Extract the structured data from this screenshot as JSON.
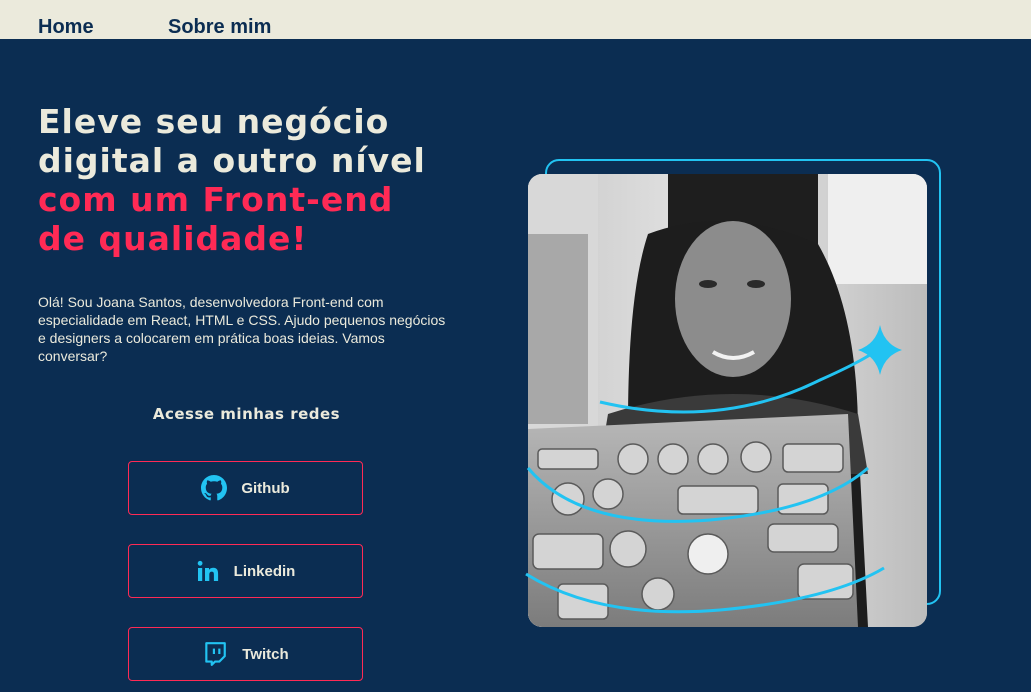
{
  "nav": {
    "home_label": "Home",
    "about_label": "Sobre mim"
  },
  "hero": {
    "title_line1": "Eleve seu negócio",
    "title_line2": "digital a outro nível",
    "title_line3": "com um Front-end",
    "title_line4": "de qualidade!",
    "intro": "Olá! Sou Joana Santos, desenvolvedora Front-end com especialidade em React, HTML e CSS. Ajudo pequenos negócios e designers a colocarem em prática boas ideias. Vamos conversar?"
  },
  "social": {
    "heading": "Acesse minhas redes",
    "buttons": [
      {
        "label": "Github",
        "icon": "github-icon"
      },
      {
        "label": "Linkedin",
        "icon": "linkedin-icon"
      },
      {
        "label": "Twitch",
        "icon": "twitch-icon"
      }
    ]
  },
  "colors": {
    "background": "#0b2d52",
    "topbar": "#ebeadc",
    "accent": "#ff2a55",
    "highlight": "#22c3f2",
    "text_light": "#ebeadc"
  }
}
